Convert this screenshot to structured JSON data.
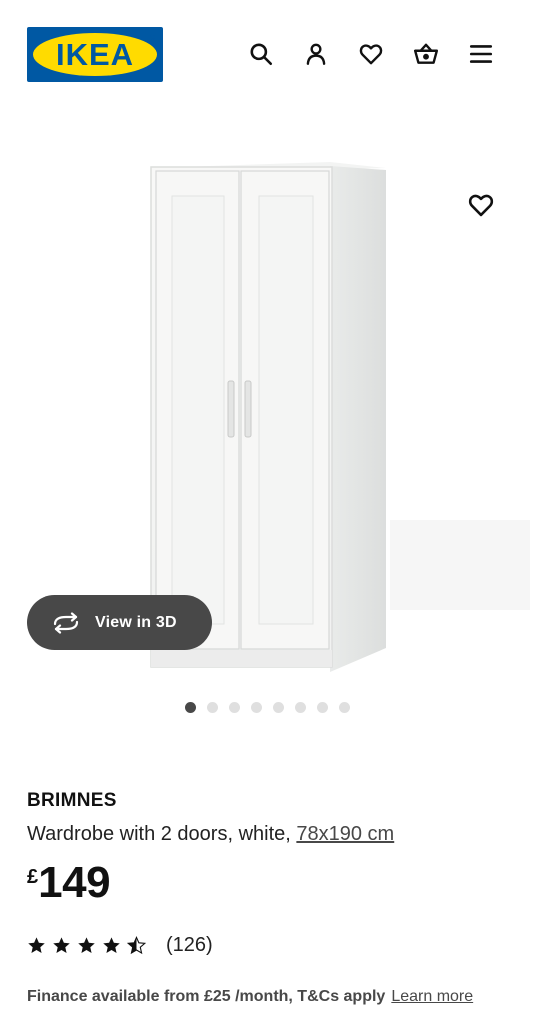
{
  "header": {
    "logo_text": "IKEA",
    "logo_registered": "®",
    "brand_colors": {
      "blue": "#0058a3",
      "yellow": "#ffdb00"
    },
    "icons": [
      "search-icon",
      "account-icon",
      "favourites-icon",
      "basket-icon",
      "menu-icon"
    ]
  },
  "gallery": {
    "view3d_label": "View in 3D",
    "favourite_icon": "heart-icon",
    "image_count": 8,
    "active_index": 0
  },
  "product": {
    "name": "BRIMNES",
    "description": "Wardrobe with 2 doors, white, ",
    "size": "78x190 cm",
    "currency": "£",
    "price": "149",
    "rating_value": 4.5,
    "rating_max": 5,
    "rating_count": "(126)"
  },
  "finance": {
    "text": "Finance available from £25 /month, T&Cs apply",
    "link": "Learn more"
  }
}
